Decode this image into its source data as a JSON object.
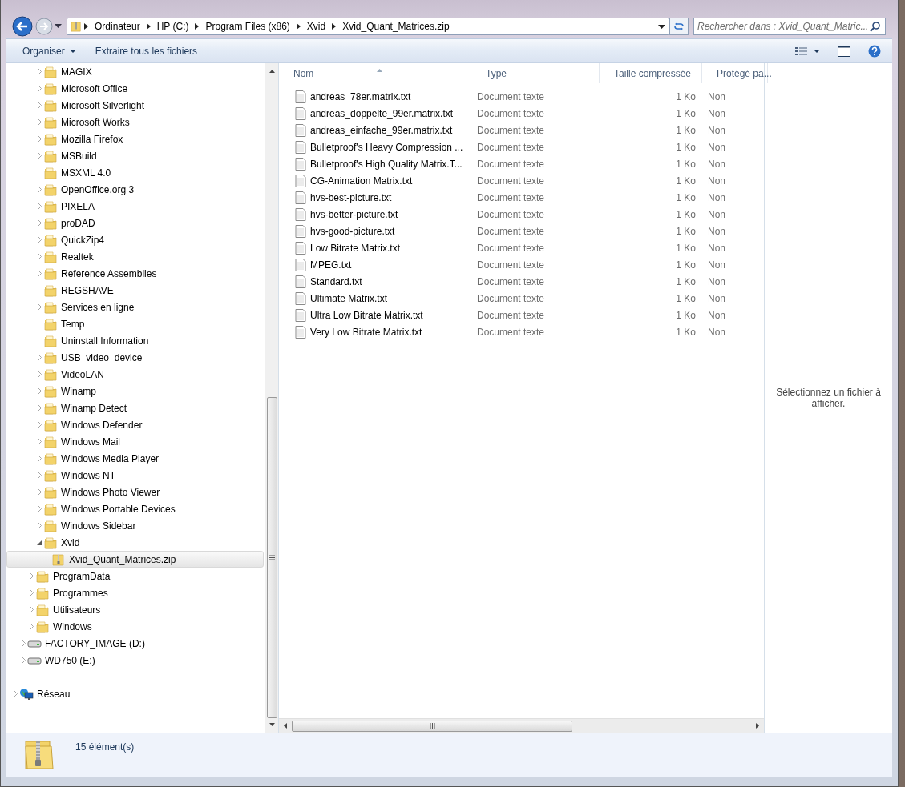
{
  "address_bar": {
    "breadcrumbs": [
      "Ordinateur",
      "HP (C:)",
      "Program Files (x86)",
      "Xvid",
      "Xvid_Quant_Matrices.zip"
    ],
    "search": {
      "placeholder": "Rechercher dans : Xvid_Quant_Matric..."
    }
  },
  "toolbar": {
    "buttons": [
      {
        "label": "Organiser",
        "dropdown": true
      },
      {
        "label": "Extraire tous les fichiers",
        "dropdown": false
      }
    ]
  },
  "tree": [
    {
      "children": [
        {
          "children": [
            {
              "children": [
                {
                  "label": "MAGIX",
                  "kind": "folder",
                  "expanded": false,
                  "selected": false
                },
                {
                  "label": "Microsoft Office",
                  "kind": "folder",
                  "expanded": false,
                  "selected": false
                },
                {
                  "label": "Microsoft Silverlight",
                  "kind": "folder",
                  "expanded": false,
                  "selected": false
                },
                {
                  "label": "Microsoft Works",
                  "kind": "folder",
                  "expanded": false,
                  "selected": false
                },
                {
                  "label": "Mozilla Firefox",
                  "kind": "folder",
                  "expanded": false,
                  "selected": false
                },
                {
                  "label": "MSBuild",
                  "kind": "folder",
                  "expanded": false,
                  "selected": false
                },
                {
                  "label": "MSXML 4.0",
                  "kind": "folder",
                  "selected": false
                },
                {
                  "label": "OpenOffice.org 3",
                  "kind": "folder",
                  "expanded": false,
                  "selected": false
                },
                {
                  "label": "PIXELA",
                  "kind": "folder",
                  "expanded": false,
                  "selected": false
                },
                {
                  "label": "proDAD",
                  "kind": "folder",
                  "expanded": false,
                  "selected": false
                },
                {
                  "label": "QuickZip4",
                  "kind": "folder",
                  "expanded": false,
                  "selected": false
                },
                {
                  "label": "Realtek",
                  "kind": "folder",
                  "expanded": false,
                  "selected": false
                },
                {
                  "label": "Reference Assemblies",
                  "kind": "folder",
                  "expanded": false,
                  "selected": false
                },
                {
                  "label": "REGSHAVE",
                  "kind": "folder",
                  "selected": false
                },
                {
                  "label": "Services en ligne",
                  "kind": "folder",
                  "expanded": false,
                  "selected": false
                },
                {
                  "label": "Temp",
                  "kind": "folder",
                  "selected": false
                },
                {
                  "label": "Uninstall Information",
                  "kind": "folder",
                  "selected": false
                },
                {
                  "label": "USB_video_device",
                  "kind": "folder",
                  "expanded": false,
                  "selected": false
                },
                {
                  "label": "VideoLAN",
                  "kind": "folder",
                  "expanded": false,
                  "selected": false
                },
                {
                  "label": "Winamp",
                  "kind": "folder",
                  "expanded": false,
                  "selected": false
                },
                {
                  "label": "Winamp Detect",
                  "kind": "folder",
                  "expanded": false,
                  "selected": false
                },
                {
                  "label": "Windows Defender",
                  "kind": "folder",
                  "expanded": false,
                  "selected": false
                },
                {
                  "label": "Windows Mail",
                  "kind": "folder",
                  "expanded": false,
                  "selected": false
                },
                {
                  "label": "Windows Media Player",
                  "kind": "folder",
                  "expanded": false,
                  "selected": false
                },
                {
                  "label": "Windows NT",
                  "kind": "folder",
                  "expanded": false,
                  "selected": false
                },
                {
                  "label": "Windows Photo Viewer",
                  "kind": "folder",
                  "expanded": false,
                  "selected": false
                },
                {
                  "label": "Windows Portable Devices",
                  "kind": "folder",
                  "expanded": false,
                  "selected": false
                },
                {
                  "label": "Windows Sidebar",
                  "kind": "folder",
                  "expanded": false,
                  "selected": false
                },
                {
                  "label": "Xvid",
                  "kind": "folder",
                  "expanded": true,
                  "selected": false,
                  "children": [
                    {
                      "label": "Xvid_Quant_Matrices.zip",
                      "kind": "zip",
                      "selected": true
                    }
                  ]
                }
              ]
            },
            {
              "label": "ProgramData",
              "kind": "folder",
              "expanded": false,
              "selected": false
            },
            {
              "label": "Programmes",
              "kind": "folder",
              "expanded": false,
              "selected": false
            },
            {
              "label": "Utilisateurs",
              "kind": "folder",
              "expanded": false,
              "selected": false
            },
            {
              "label": "Windows",
              "kind": "folder",
              "expanded": false,
              "selected": false
            }
          ]
        },
        {
          "label": "FACTORY_IMAGE (D:)",
          "kind": "drive",
          "expanded": false,
          "selected": false
        },
        {
          "label": "WD750 (E:)",
          "kind": "drive",
          "expanded": false,
          "selected": false
        }
      ]
    },
    {
      "label": "Réseau",
      "kind": "network",
      "expanded": false,
      "selected": false
    }
  ],
  "file_list": {
    "columns": [
      "Nom",
      "Type",
      "Taille compressée",
      "Protégé pa..."
    ],
    "rows": [
      {
        "name": "andreas_78er.matrix.txt",
        "type": "Document texte",
        "size": "1 Ko",
        "protected": "Non",
        "selected": false
      },
      {
        "name": "andreas_doppelte_99er.matrix.txt",
        "type": "Document texte",
        "size": "1 Ko",
        "protected": "Non",
        "selected": false
      },
      {
        "name": "andreas_einfache_99er.matrix.txt",
        "type": "Document texte",
        "size": "1 Ko",
        "protected": "Non",
        "selected": false
      },
      {
        "name": "Bulletproof's Heavy Compression ...",
        "type": "Document texte",
        "size": "1 Ko",
        "protected": "Non",
        "selected": false
      },
      {
        "name": "Bulletproof's High Quality Matrix.T...",
        "type": "Document texte",
        "size": "1 Ko",
        "protected": "Non",
        "selected": false
      },
      {
        "name": "CG-Animation Matrix.txt",
        "type": "Document texte",
        "size": "1 Ko",
        "protected": "Non",
        "selected": false
      },
      {
        "name": "hvs-best-picture.txt",
        "type": "Document texte",
        "size": "1 Ko",
        "protected": "Non",
        "selected": false
      },
      {
        "name": "hvs-better-picture.txt",
        "type": "Document texte",
        "size": "1 Ko",
        "protected": "Non",
        "selected": false
      },
      {
        "name": "hvs-good-picture.txt",
        "type": "Document texte",
        "size": "1 Ko",
        "protected": "Non",
        "selected": false
      },
      {
        "name": "Low Bitrate Matrix.txt",
        "type": "Document texte",
        "size": "1 Ko",
        "protected": "Non",
        "selected": false
      },
      {
        "name": "MPEG.txt",
        "type": "Document texte",
        "size": "1 Ko",
        "protected": "Non",
        "selected": false
      },
      {
        "name": "Standard.txt",
        "type": "Document texte",
        "size": "1 Ko",
        "protected": "Non",
        "selected": false
      },
      {
        "name": "Ultimate Matrix.txt",
        "type": "Document texte",
        "size": "1 Ko",
        "protected": "Non",
        "selected": false
      },
      {
        "name": "Ultra Low Bitrate Matrix.txt",
        "type": "Document texte",
        "size": "1 Ko",
        "protected": "Non",
        "selected": false
      },
      {
        "name": "Very Low Bitrate Matrix.txt",
        "type": "Document texte",
        "size": "1 Ko",
        "protected": "Non",
        "selected": false
      }
    ]
  },
  "preview_pane": {
    "message": "Sélectionnez un fichier à afficher."
  },
  "status_bar": {
    "item_count": "15 élément(s)"
  }
}
